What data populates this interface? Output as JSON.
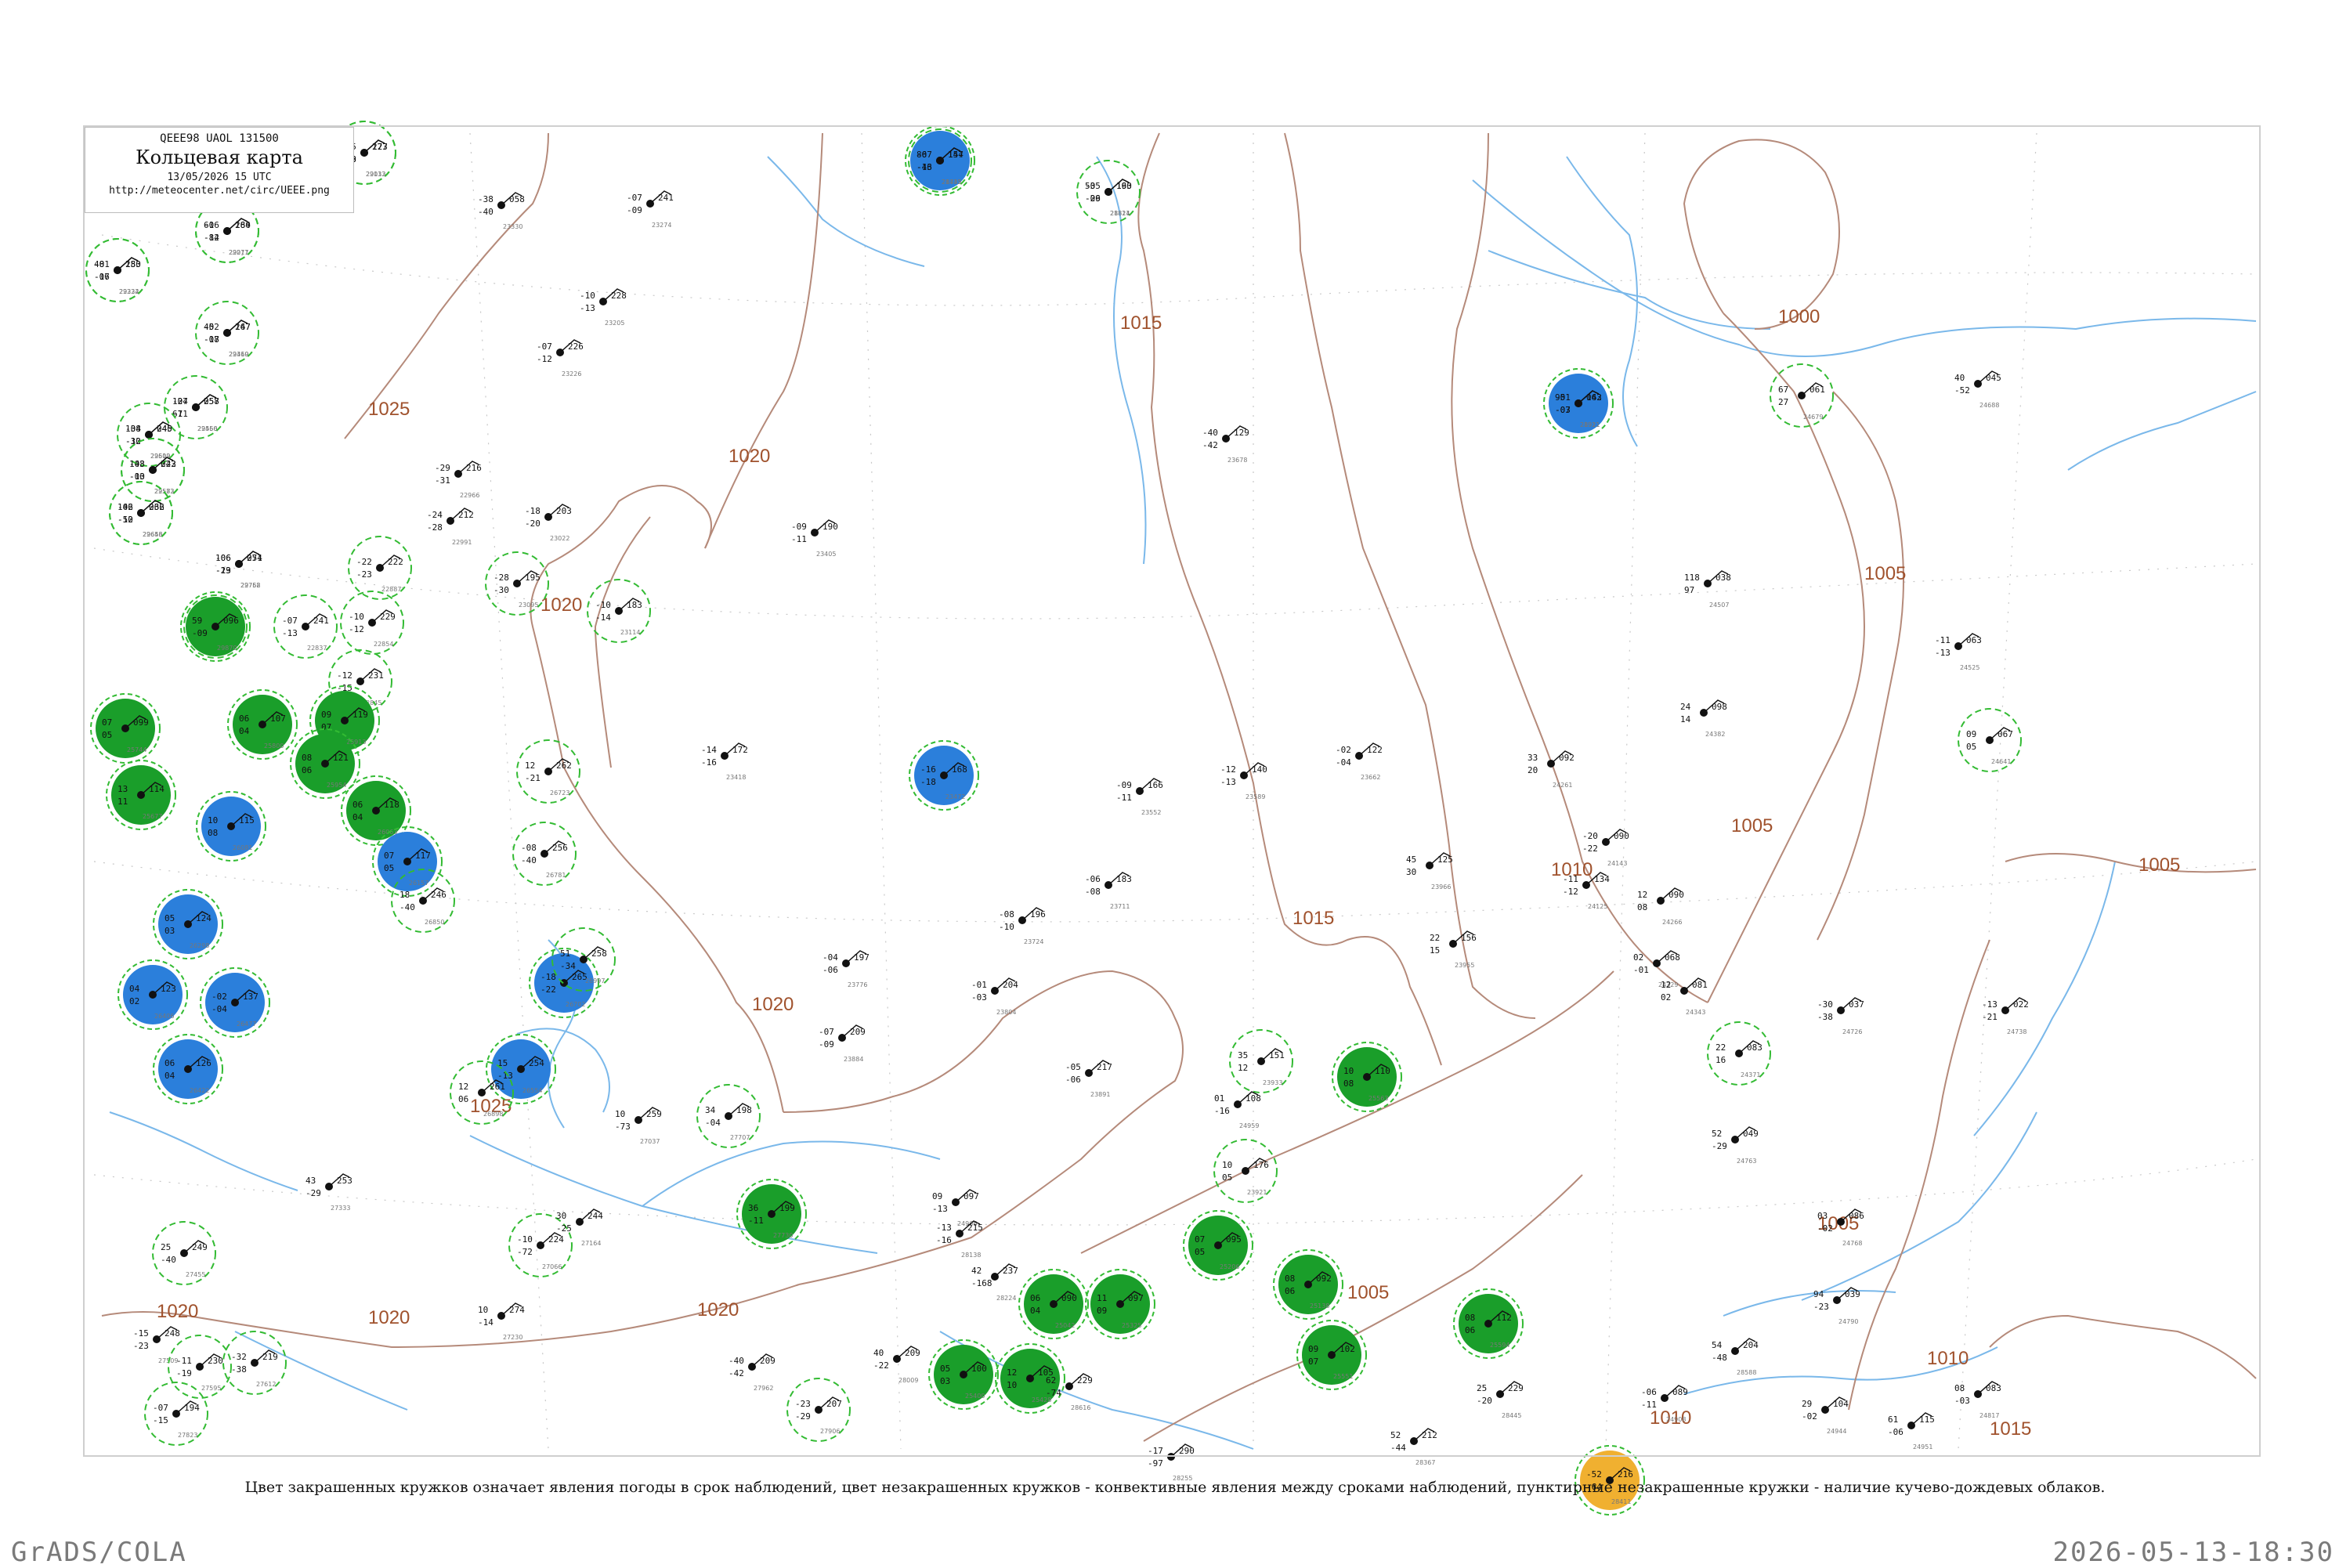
{
  "header": {
    "code_line": "QEEE98  UAOL  131500",
    "title": "Кольцевая карта",
    "datetime": "13/05/2026 15 UTC",
    "url": "http://meteocenter.net/circ/UEEE.png"
  },
  "caption": "Цвет закрашенных кружков означает явления погоды в срок наблюдений, цвет незакрашенных кружков - конвективные явления между сроками наблюдений, пунктирные незакрашенные кружки - наличие кучево-дождевых облаков.",
  "footer": {
    "left": "GrADS/COLA",
    "right": "2026-05-13-18:30"
  },
  "colors": {
    "isobar": "#a0522d",
    "river": "#7ab8ea",
    "dashed_circle": "#33bb33",
    "rain_fill": "#1a9e2a",
    "snow_fill": "#2b7fdb",
    "other_fill": "#f0b030",
    "station_text": "#111111"
  },
  "isobar_labels": [
    {
      "text": "1025"
    },
    {
      "text": "1020"
    },
    {
      "text": "1020"
    },
    {
      "text": "1020"
    },
    {
      "text": "1020"
    },
    {
      "text": "1020"
    },
    {
      "text": "1020"
    },
    {
      "text": "1015"
    },
    {
      "text": "1015"
    },
    {
      "text": "1010"
    },
    {
      "text": "1005"
    },
    {
      "text": "1005"
    },
    {
      "text": "1005"
    },
    {
      "text": "1005"
    },
    {
      "text": "1005"
    },
    {
      "text": "1000"
    },
    {
      "text": "1010"
    },
    {
      "text": "1010"
    },
    {
      "text": "1015"
    },
    {
      "text": "1025"
    }
  ],
  "stations": [
    {
      "id": "21432",
      "p": "147",
      "t": "-07",
      "td": "-13",
      "mark": "snow-fill"
    },
    {
      "id": "21824",
      "p": "160",
      "t": "-05",
      "td": "-09",
      "mark": "dashed-snow"
    },
    {
      "id": "21921",
      "p": "063",
      "t": "-01",
      "td": "-07",
      "mark": "snow-fill"
    },
    {
      "id": "22113",
      "p": "277",
      "t": "-05",
      "td": "-09",
      "mark": "dashed"
    },
    {
      "id": "22217",
      "p": "280",
      "t": "-06",
      "td": "-14",
      "mark": "dashed"
    },
    {
      "id": "22324",
      "p": "283",
      "t": "-01",
      "td": "-07",
      "mark": "dashed"
    },
    {
      "id": "22410",
      "p": "267",
      "t": "-02",
      "td": "-08",
      "mark": "dashed"
    },
    {
      "id": "22550",
      "p": "257",
      "t": "-04",
      "td": "-11",
      "mark": "dashed"
    },
    {
      "id": "22602",
      "p": "245",
      "t": "-04",
      "td": "-12",
      "mark": "plain"
    },
    {
      "id": "22583",
      "p": "243",
      "t": "-03",
      "td": "-10",
      "mark": "dashed-snow"
    },
    {
      "id": "22656",
      "p": "262",
      "t": "-06",
      "td": "-12",
      "mark": "dashed-snow"
    },
    {
      "id": "22762",
      "p": "251",
      "t": "-06",
      "td": "-13",
      "mark": "plain"
    },
    {
      "id": "22802",
      "p": "254",
      "t": "-04",
      "td": "-09",
      "mark": "dashed"
    },
    {
      "id": "22837",
      "p": "241",
      "t": "-07",
      "td": "-13",
      "mark": "dashed"
    },
    {
      "id": "22845",
      "p": "231",
      "t": "-12",
      "td": "-15",
      "mark": "dashed"
    },
    {
      "id": "22854",
      "p": "229",
      "t": "-10",
      "td": "-12",
      "mark": "dashed"
    },
    {
      "id": "22887",
      "p": "222",
      "t": "-22",
      "td": "-23",
      "mark": "dashed"
    },
    {
      "id": "22966",
      "p": "216",
      "t": "-29",
      "td": "-31",
      "mark": "plain"
    },
    {
      "id": "22991",
      "p": "212",
      "t": "-24",
      "td": "-28",
      "mark": "plain"
    },
    {
      "id": "23022",
      "p": "203",
      "t": "-18",
      "td": "-20",
      "mark": "plain"
    },
    {
      "id": "23095",
      "p": "195",
      "t": "-28",
      "td": "-30",
      "mark": "dashed"
    },
    {
      "id": "23114",
      "p": "183",
      "t": "-10",
      "td": "-14",
      "mark": "dashed"
    },
    {
      "id": "23205",
      "p": "228",
      "t": "-10",
      "td": "-13",
      "mark": "plain"
    },
    {
      "id": "23226",
      "p": "226",
      "t": "-07",
      "td": "-12",
      "mark": "plain"
    },
    {
      "id": "23274",
      "p": "241",
      "t": "-07",
      "td": "-09",
      "mark": "plain"
    },
    {
      "id": "23330",
      "p": "058",
      "t": "-38",
      "td": "-40",
      "mark": "plain"
    },
    {
      "id": "23405",
      "p": "190",
      "t": "-09",
      "td": "-11",
      "mark": "plain"
    },
    {
      "id": "23418",
      "p": "172",
      "t": "-14",
      "td": "-16",
      "mark": "plain"
    },
    {
      "id": "23472",
      "p": "168",
      "t": "-16",
      "td": "-18",
      "mark": "snow-fill"
    },
    {
      "id": "23552",
      "p": "166",
      "t": "-09",
      "td": "-11",
      "mark": "plain"
    },
    {
      "id": "23589",
      "p": "140",
      "t": "-12",
      "td": "-13",
      "mark": "plain"
    },
    {
      "id": "23662",
      "p": "122",
      "t": "-02",
      "td": "-04",
      "mark": "plain"
    },
    {
      "id": "23678",
      "p": "129",
      "t": "-40",
      "td": "-42",
      "mark": "plain"
    },
    {
      "id": "23711",
      "p": "183",
      "t": "-06",
      "td": "-08",
      "mark": "plain"
    },
    {
      "id": "23724",
      "p": "196",
      "t": "-08",
      "td": "-10",
      "mark": "plain"
    },
    {
      "id": "23776",
      "p": "197",
      "t": "-04",
      "td": "-06",
      "mark": "plain"
    },
    {
      "id": "23804",
      "p": "204",
      "t": "-01",
      "td": "-03",
      "mark": "plain"
    },
    {
      "id": "23884",
      "p": "209",
      "t": "-07",
      "td": "-09",
      "mark": "plain"
    },
    {
      "id": "23891",
      "p": "217",
      "t": "-05",
      "td": "-06",
      "mark": "plain"
    },
    {
      "id": "23921",
      "p": "176",
      "t": "10",
      "td": "05",
      "mark": "dashed"
    },
    {
      "id": "23933",
      "p": "151",
      "t": "35",
      "td": "12",
      "mark": "dashed"
    },
    {
      "id": "23955",
      "p": "156",
      "t": "22",
      "td": "15",
      "mark": "plain"
    },
    {
      "id": "23966",
      "p": "125",
      "t": "45",
      "td": "30",
      "mark": "plain"
    },
    {
      "id": "24125",
      "p": "134",
      "t": "-11",
      "td": "-12",
      "mark": "plain"
    },
    {
      "id": "24143",
      "p": "090",
      "t": "-20",
      "td": "-22",
      "mark": "plain"
    },
    {
      "id": "24261",
      "p": "092",
      "t": "33",
      "td": "20",
      "mark": "plain"
    },
    {
      "id": "24266",
      "p": "090",
      "t": "12",
      "td": "08",
      "mark": "plain"
    },
    {
      "id": "24329",
      "p": "068",
      "t": "02",
      "td": "-01",
      "mark": "plain"
    },
    {
      "id": "24343",
      "p": "081",
      "t": "12",
      "td": "02",
      "mark": "plain"
    },
    {
      "id": "24371",
      "p": "083",
      "t": "22",
      "td": "16",
      "mark": "dashed"
    },
    {
      "id": "24382",
      "p": "098",
      "t": "24",
      "td": "14",
      "mark": "plain"
    },
    {
      "id": "24507",
      "p": "038",
      "t": "118",
      "td": "97",
      "mark": "plain"
    },
    {
      "id": "24525",
      "p": "063",
      "t": "-11",
      "td": "-13",
      "mark": "plain"
    },
    {
      "id": "24641",
      "p": "067",
      "t": "09",
      "td": "05",
      "mark": "dashed"
    },
    {
      "id": "24679",
      "p": "061",
      "t": "67",
      "td": "27",
      "mark": "dashed"
    },
    {
      "id": "24688",
      "p": "045",
      "t": "40",
      "td": "-52",
      "mark": "plain"
    },
    {
      "id": "24726",
      "p": "037",
      "t": "-30",
      "td": "-38",
      "mark": "plain"
    },
    {
      "id": "24738",
      "p": "022",
      "t": "-13",
      "td": "-21",
      "mark": "plain"
    },
    {
      "id": "24763",
      "p": "049",
      "t": "52",
      "td": "-29",
      "mark": "plain"
    },
    {
      "id": "24768",
      "p": "086",
      "t": "03",
      "td": "-02",
      "mark": "plain"
    },
    {
      "id": "24790",
      "p": "039",
      "t": "94",
      "td": "-23",
      "mark": "plain"
    },
    {
      "id": "24817",
      "p": "083",
      "t": "08",
      "td": "-03",
      "mark": "plain"
    },
    {
      "id": "24908",
      "p": "089",
      "t": "-06",
      "td": "-11",
      "mark": "plain"
    },
    {
      "id": "24944",
      "p": "104",
      "t": "29",
      "td": "-02",
      "mark": "plain"
    },
    {
      "id": "24951",
      "p": "115",
      "t": "61",
      "td": "-06",
      "mark": "plain"
    },
    {
      "id": "24959",
      "p": "108",
      "t": "01",
      "td": "-16",
      "mark": "plain"
    },
    {
      "id": "24966",
      "p": "097",
      "t": "09",
      "td": "-13",
      "mark": "plain"
    },
    {
      "id": "25042",
      "p": "090",
      "t": "06",
      "td": "04",
      "mark": "rain-fill"
    },
    {
      "id": "25138",
      "p": "092",
      "t": "08",
      "td": "06",
      "mark": "rain-fill"
    },
    {
      "id": "25206",
      "p": "095",
      "t": "07",
      "td": "05",
      "mark": "rain-fill"
    },
    {
      "id": "25325",
      "p": "097",
      "t": "11",
      "td": "09",
      "mark": "rain-fill"
    },
    {
      "id": "25400",
      "p": "100",
      "t": "05",
      "td": "03",
      "mark": "rain-fill"
    },
    {
      "id": "25428",
      "p": "105",
      "t": "12",
      "td": "10",
      "mark": "rain-fill"
    },
    {
      "id": "25551",
      "p": "102",
      "t": "09",
      "td": "07",
      "mark": "rain-fill"
    },
    {
      "id": "25563",
      "p": "110",
      "t": "10",
      "td": "08",
      "mark": "rain-fill"
    },
    {
      "id": "25594",
      "p": "112",
      "t": "08",
      "td": "06",
      "mark": "rain-fill"
    },
    {
      "id": "25677",
      "p": "114",
      "t": "13",
      "td": "11",
      "mark": "rain-fill"
    },
    {
      "id": "25744",
      "p": "099",
      "t": "07",
      "td": "05",
      "mark": "rain-fill"
    },
    {
      "id": "25800",
      "p": "107",
      "t": "06",
      "td": "04",
      "mark": "rain-fill"
    },
    {
      "id": "25913",
      "p": "119",
      "t": "09",
      "td": "07",
      "mark": "rain-fill"
    },
    {
      "id": "25954",
      "p": "121",
      "t": "08",
      "td": "06",
      "mark": "rain-fill"
    },
    {
      "id": "26063",
      "p": "118",
      "t": "06",
      "td": "04",
      "mark": "rain-fill"
    },
    {
      "id": "26081",
      "p": "115",
      "t": "10",
      "td": "08",
      "mark": "snow-fill"
    },
    {
      "id": "26157",
      "p": "117",
      "t": "07",
      "td": "05",
      "mark": "snow-fill"
    },
    {
      "id": "26298",
      "p": "124",
      "t": "05",
      "td": "03",
      "mark": "snow-fill"
    },
    {
      "id": "26406",
      "p": "123",
      "t": "04",
      "td": "02",
      "mark": "snow-fill"
    },
    {
      "id": "26422",
      "p": "126",
      "t": "06",
      "td": "04",
      "mark": "snow-fill"
    },
    {
      "id": "26477",
      "p": "137",
      "t": "-02",
      "td": "-04",
      "mark": "snow-fill"
    },
    {
      "id": "26554",
      "p": "254",
      "t": "15",
      "td": "-13",
      "mark": "snow-fill"
    },
    {
      "id": "26702",
      "p": "265",
      "t": "-18",
      "td": "-22",
      "mark": "snow-fill"
    },
    {
      "id": "26723",
      "p": "262",
      "t": "12",
      "td": "-21",
      "mark": "dashed"
    },
    {
      "id": "26781",
      "p": "256",
      "t": "-08",
      "td": "-40",
      "mark": "dashed"
    },
    {
      "id": "26850",
      "p": "246",
      "t": "18",
      "td": "-40",
      "mark": "dashed"
    },
    {
      "id": "26898",
      "p": "261",
      "t": "12",
      "td": "06",
      "mark": "dashed"
    },
    {
      "id": "26997",
      "p": "258",
      "t": "51",
      "td": "-34",
      "mark": "dashed"
    },
    {
      "id": "27037",
      "p": "259",
      "t": "10",
      "td": "-73",
      "mark": "plain"
    },
    {
      "id": "27066",
      "p": "224",
      "t": "-10",
      "td": "-72",
      "mark": "dashed"
    },
    {
      "id": "27164",
      "p": "244",
      "t": "30",
      "td": "-25",
      "mark": "plain"
    },
    {
      "id": "27230",
      "p": "274",
      "t": "10",
      "td": "-14",
      "mark": "plain"
    },
    {
      "id": "27333",
      "p": "253",
      "t": "43",
      "td": "-29",
      "mark": "plain"
    },
    {
      "id": "27455",
      "p": "249",
      "t": "25",
      "td": "-40",
      "mark": "dashed"
    },
    {
      "id": "27509",
      "p": "248",
      "t": "-15",
      "td": "-23",
      "mark": "plain"
    },
    {
      "id": "27595",
      "p": "230",
      "t": "-11",
      "td": "-19",
      "mark": "dashed"
    },
    {
      "id": "27612",
      "p": "219",
      "t": "-32",
      "td": "-38",
      "mark": "dashed"
    },
    {
      "id": "27707",
      "p": "198",
      "t": "34",
      "td": "-04",
      "mark": "dashed"
    },
    {
      "id": "27730",
      "p": "199",
      "t": "36",
      "td": "-11",
      "mark": "rain-fill"
    },
    {
      "id": "27823",
      "p": "194",
      "t": "-07",
      "td": "-15",
      "mark": "dashed"
    },
    {
      "id": "27906",
      "p": "207",
      "t": "-23",
      "td": "-29",
      "mark": "dashed"
    },
    {
      "id": "27962",
      "p": "209",
      "t": "-40",
      "td": "-42",
      "mark": "plain"
    },
    {
      "id": "28009",
      "p": "209",
      "t": "40",
      "td": "-22",
      "mark": "plain"
    },
    {
      "id": "28138",
      "p": "215",
      "t": "-13",
      "td": "-16",
      "mark": "plain"
    },
    {
      "id": "28224",
      "p": "237",
      "t": "42",
      "td": "-168",
      "mark": "plain"
    },
    {
      "id": "28255",
      "p": "290",
      "t": "-17",
      "td": "-97",
      "mark": "plain"
    },
    {
      "id": "28367",
      "p": "212",
      "t": "52",
      "td": "-44",
      "mark": "plain"
    },
    {
      "id": "28411",
      "p": "216",
      "t": "-52",
      "td": "-64",
      "mark": "other-fill"
    },
    {
      "id": "28445",
      "p": "229",
      "t": "25",
      "td": "-20",
      "mark": "plain"
    },
    {
      "id": "28588",
      "p": "204",
      "t": "54",
      "td": "-48",
      "mark": "plain"
    },
    {
      "id": "28616",
      "p": "229",
      "t": "62",
      "td": "-74",
      "mark": "plain"
    },
    {
      "id": "28745",
      "p": "154",
      "t": "86",
      "td": "-46",
      "mark": "dashed"
    },
    {
      "id": "28811",
      "p": "193",
      "t": "53",
      "td": "-26",
      "mark": "plain"
    },
    {
      "id": "28911",
      "p": "142",
      "t": "95",
      "td": "-03",
      "mark": "plain"
    },
    {
      "id": "29032",
      "p": "123",
      "t": "97",
      "td": "-08",
      "mark": "dashed"
    },
    {
      "id": "29071",
      "p": "164",
      "t": "61",
      "td": "-82",
      "mark": "dashed"
    },
    {
      "id": "29232",
      "p": "150",
      "t": "48",
      "td": "-16",
      "mark": "dashed"
    },
    {
      "id": "29369",
      "p": "147",
      "t": "45",
      "td": "-17",
      "mark": "plain"
    },
    {
      "id": "29466",
      "p": "058",
      "t": "127",
      "td": "67",
      "mark": "plain"
    },
    {
      "id": "29519",
      "p": "040",
      "t": "138",
      "td": "-30",
      "mark": "dashed"
    },
    {
      "id": "29572",
      "p": "022",
      "t": "148",
      "td": "-03",
      "mark": "dashed"
    },
    {
      "id": "29643",
      "p": "036",
      "t": "142",
      "td": "-50",
      "mark": "dashed"
    },
    {
      "id": "29758",
      "p": "074",
      "t": "106",
      "td": "-29",
      "mark": "plain"
    },
    {
      "id": "29870",
      "p": "096",
      "t": "59",
      "td": "-09",
      "mark": "rain-fill"
    }
  ]
}
